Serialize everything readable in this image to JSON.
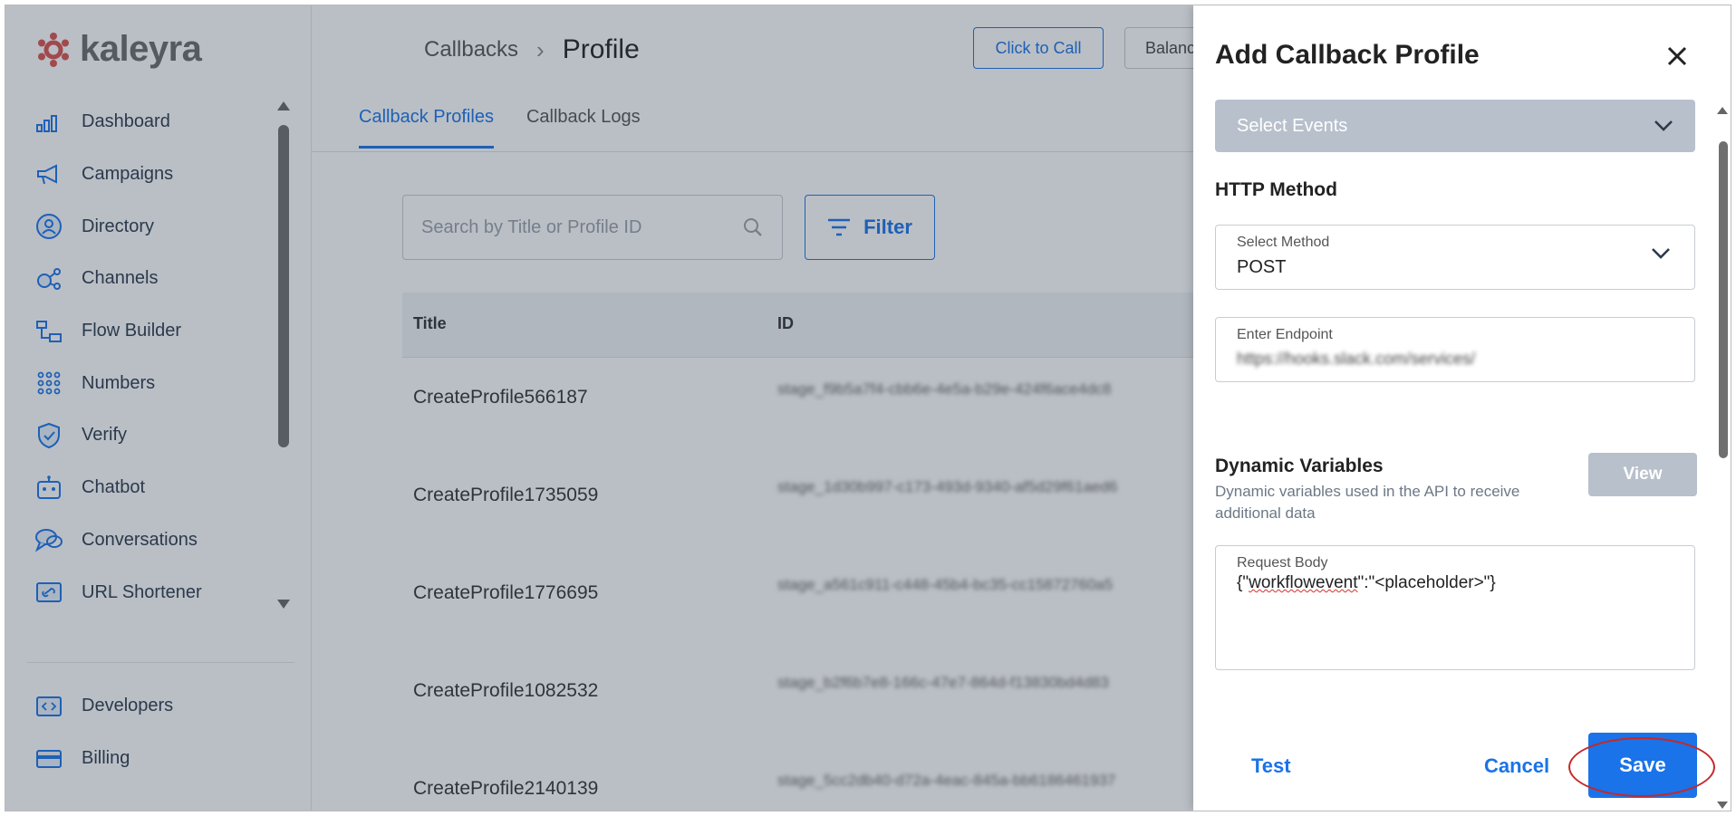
{
  "brand": {
    "name": "kaleyra",
    "accent": "#1a73e8",
    "logo_color": "#d9534f"
  },
  "sidebar": {
    "items": [
      {
        "label": "Dashboard",
        "icon": "bar-chart-icon"
      },
      {
        "label": "Campaigns",
        "icon": "megaphone-icon"
      },
      {
        "label": "Directory",
        "icon": "user-circle-icon"
      },
      {
        "label": "Channels",
        "icon": "nodes-icon"
      },
      {
        "label": "Flow Builder",
        "icon": "flow-icon"
      },
      {
        "label": "Numbers",
        "icon": "dial-pad-icon"
      },
      {
        "label": "Verify",
        "icon": "shield-check-icon"
      },
      {
        "label": "Chatbot",
        "icon": "robot-icon"
      },
      {
        "label": "Conversations",
        "icon": "chat-bubbles-icon"
      },
      {
        "label": "URL Shortener",
        "icon": "link-icon"
      }
    ],
    "bottom": [
      {
        "label": "Developers",
        "icon": "code-icon"
      },
      {
        "label": "Billing",
        "icon": "card-icon"
      }
    ]
  },
  "header": {
    "breadcrumb_parent": "Callbacks",
    "breadcrumb_current": "Profile",
    "click_to_call": "Click to Call",
    "balance": "Balanc"
  },
  "tabs": [
    {
      "label": "Callback Profiles"
    },
    {
      "label": "Callback Logs"
    }
  ],
  "search": {
    "placeholder": "Search by Title or Profile ID"
  },
  "filter_label": "Filter",
  "table": {
    "headers": [
      "Title",
      "ID"
    ],
    "rows": [
      {
        "title": "CreateProfile566187",
        "id": "stage_f9b5a7f4-cbb6e-4e5a-b29e-424f6ace4dc8"
      },
      {
        "title": "CreateProfile1735059",
        "id": "stage_1d30b997-c173-493d-9340-af5d29f61aed6"
      },
      {
        "title": "CreateProfile1776695",
        "id": "stage_a561c911-c448-45b4-bc35-cc15872760a5"
      },
      {
        "title": "CreateProfile1082532",
        "id": "stage_b2f6b7e8-166c-47e7-864d-f13830bd4d83"
      },
      {
        "title": "CreateProfile2140139",
        "id": "stage_5cc2db40-d72a-4eac-845a-bb6186461937"
      }
    ]
  },
  "drawer": {
    "title": "Add Callback Profile",
    "events_placeholder": "Select Events",
    "http_method_heading": "HTTP Method",
    "method_label": "Select Method",
    "method_value": "POST",
    "endpoint_label": "Enter Endpoint",
    "endpoint_value": "https://hooks.slack.com/services/",
    "dynamic_heading": "Dynamic Variables",
    "dynamic_desc": "Dynamic variables used in the API to receive additional data",
    "view_label": "View",
    "request_label": "Request Body",
    "request_pre": "{\"",
    "request_word": "workflowevent",
    "request_post": "\":\"<placeholder>\"}",
    "test_label": "Test",
    "cancel_label": "Cancel",
    "save_label": "Save"
  }
}
